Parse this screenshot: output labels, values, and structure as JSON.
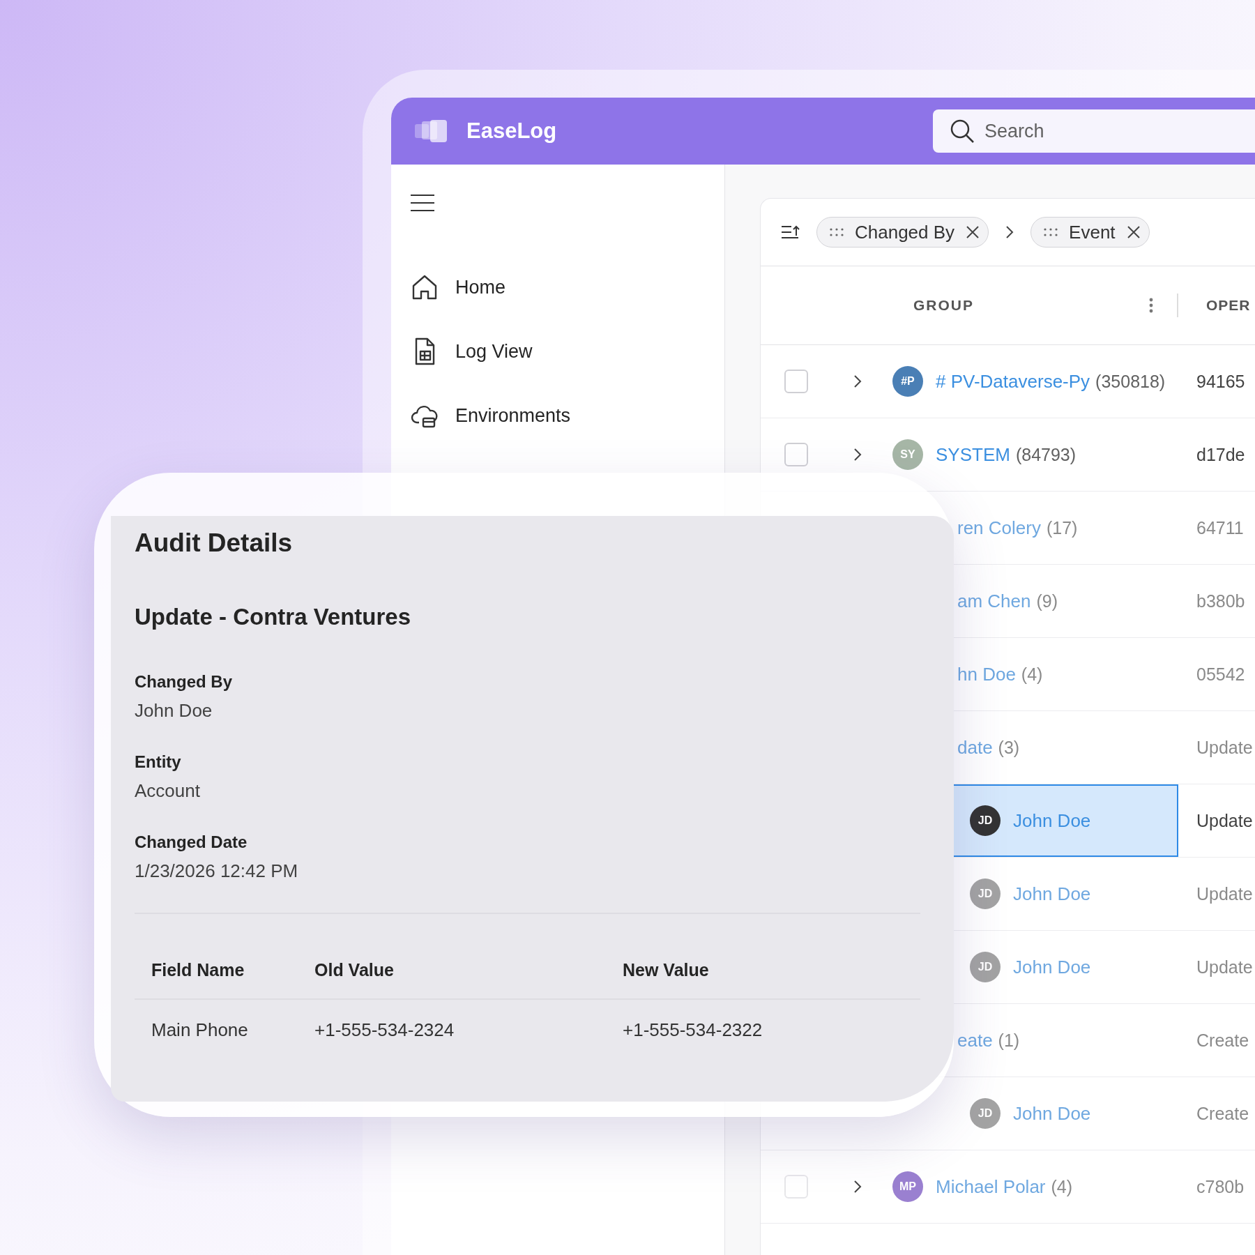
{
  "app": {
    "name": "EaseLog",
    "search": {
      "placeholder": "Search"
    }
  },
  "sidebar": {
    "items": [
      {
        "label": "Home",
        "kind": "home"
      },
      {
        "label": "Log View",
        "kind": "log"
      },
      {
        "label": "Environments",
        "kind": "cloud"
      }
    ]
  },
  "grouping": {
    "chips": [
      "Changed By",
      "Event"
    ]
  },
  "table": {
    "columns": [
      "GROUP",
      "OPER"
    ],
    "rows": [
      {
        "kind": "group",
        "selected": false,
        "checked": false,
        "faded": false,
        "avatar": "#P",
        "color": "#4a7fb5",
        "name": "# PV-Dataverse-Py",
        "count": "(350818)",
        "operation": "94165"
      },
      {
        "kind": "group",
        "selected": false,
        "checked": false,
        "faded": false,
        "avatar": "SY",
        "color": "#a6b6a6",
        "name": "SYSTEM",
        "count": "(84793)",
        "operation": "d17de"
      },
      {
        "kind": "partial",
        "selected": false,
        "faded": true,
        "name": "ren Colery",
        "count": "(17)",
        "operation": "64711"
      },
      {
        "kind": "partial",
        "selected": false,
        "faded": true,
        "name": "am Chen",
        "count": "(9)",
        "operation": "b380b"
      },
      {
        "kind": "partial",
        "selected": false,
        "faded": true,
        "name": "hn Doe",
        "count": "(4)",
        "operation": "05542"
      },
      {
        "kind": "partial",
        "selected": false,
        "faded": true,
        "name": "date",
        "count": "(3)",
        "operation": "Update"
      },
      {
        "kind": "child",
        "selected": true,
        "faded": false,
        "avatar": "JD",
        "color": "#333333",
        "name": "John Doe",
        "operation": "Update"
      },
      {
        "kind": "child",
        "selected": false,
        "faded": true,
        "avatar": "JD",
        "color": "#a3a3a3",
        "name": "John Doe",
        "operation": "Update"
      },
      {
        "kind": "child",
        "selected": false,
        "faded": true,
        "avatar": "JD",
        "color": "#a3a3a3",
        "name": "John Doe",
        "operation": "Update"
      },
      {
        "kind": "partial",
        "selected": false,
        "faded": true,
        "name": "eate",
        "count": "(1)",
        "operation": "Create"
      },
      {
        "kind": "child",
        "selected": false,
        "faded": true,
        "avatar": "JD",
        "color": "#a3a3a3",
        "name": "John Doe",
        "operation": "Create"
      },
      {
        "kind": "group",
        "selected": false,
        "checked": false,
        "faded": true,
        "avatar": "MP",
        "color": "#9a80d0",
        "name": "Michael Polar",
        "count": "(4)",
        "operation": "c780b"
      }
    ]
  },
  "dialog": {
    "title": "Audit Details",
    "subtitle": "Update - Contra Ventures",
    "fields": [
      {
        "label": "Changed By",
        "value": "John Doe"
      },
      {
        "label": "Entity",
        "value": "Account"
      },
      {
        "label": "Changed Date",
        "value": "1/23/2026 12:42 PM"
      }
    ],
    "changes": {
      "columns": [
        "Field Name",
        "Old Value",
        "New Value"
      ],
      "rows": [
        [
          "Main Phone",
          "+1-555-534-2324",
          "+1-555-534-2322"
        ]
      ]
    }
  }
}
